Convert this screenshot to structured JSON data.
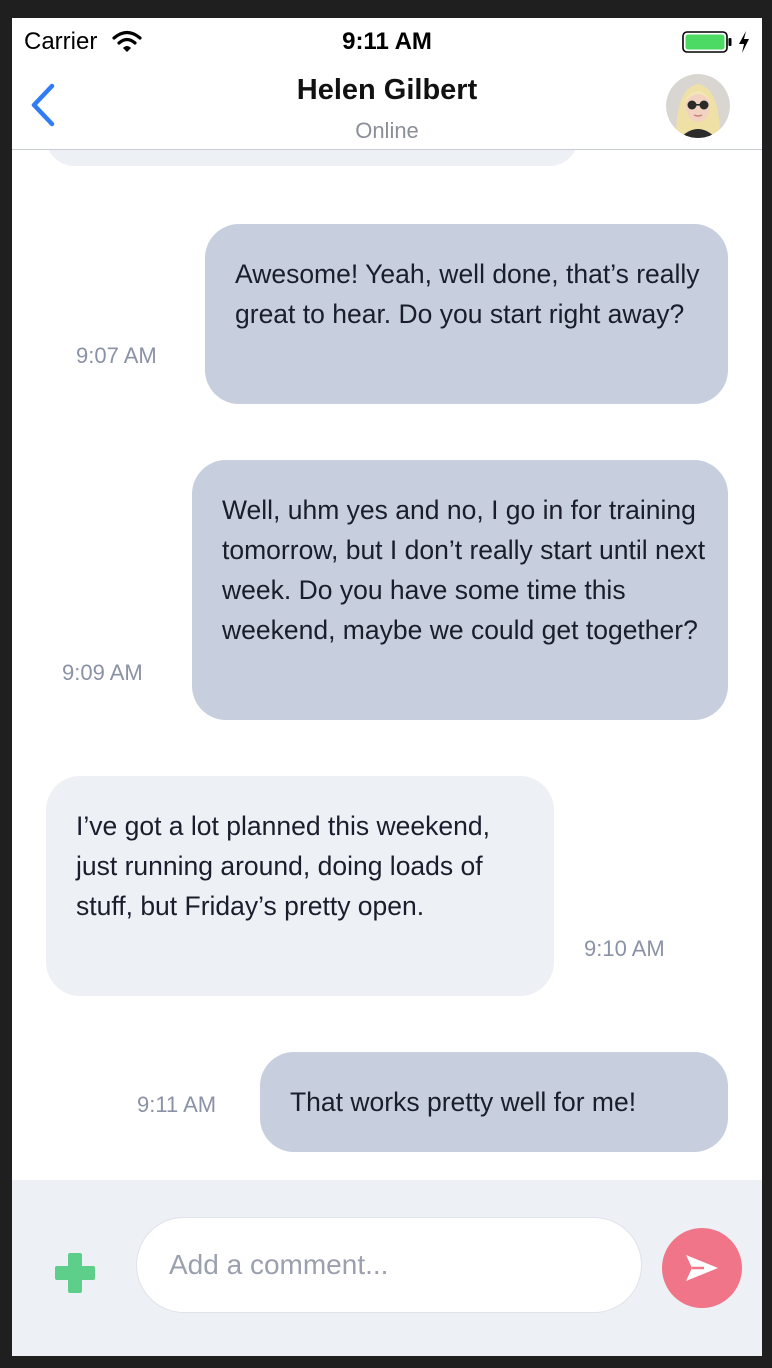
{
  "status_bar": {
    "carrier": "Carrier",
    "time": "9:11 AM",
    "icons": [
      "wifi-icon",
      "battery-icon",
      "charging-bolt-icon"
    ]
  },
  "header": {
    "contact_name": "Helen Gilbert",
    "contact_status": "Online",
    "back_icon": "chevron-left-icon",
    "avatar": "contact-avatar"
  },
  "messages": [
    {
      "direction": "outgoing",
      "text": "Awesome! Yeah, well done, that’s really great to hear. Do you start right away?",
      "time": "9:07 AM"
    },
    {
      "direction": "outgoing",
      "text": "Well, uhm yes and no, I go in for training tomorrow, but I don’t really start until next week. Do you have some time this weekend, maybe we could get together?",
      "time": "9:09 AM"
    },
    {
      "direction": "incoming",
      "text": "I’ve got a lot planned this weekend, just running around, doing loads of stuff, but Friday’s pretty open.",
      "time": "9:10 AM"
    },
    {
      "direction": "outgoing",
      "text": "That works pretty well for me!",
      "time": "9:11 AM"
    }
  ],
  "composer": {
    "placeholder": "Add a comment...",
    "value": "",
    "add_icon": "plus-icon",
    "send_icon": "send-icon"
  },
  "colors": {
    "accent_blue": "#2f7cf6",
    "incoming_bubble": "#edf0f5",
    "outgoing_bubble": "#c7cedd",
    "add_green": "#5ecf8a",
    "send_pink": "#f07588",
    "battery_green": "#4cd964"
  }
}
